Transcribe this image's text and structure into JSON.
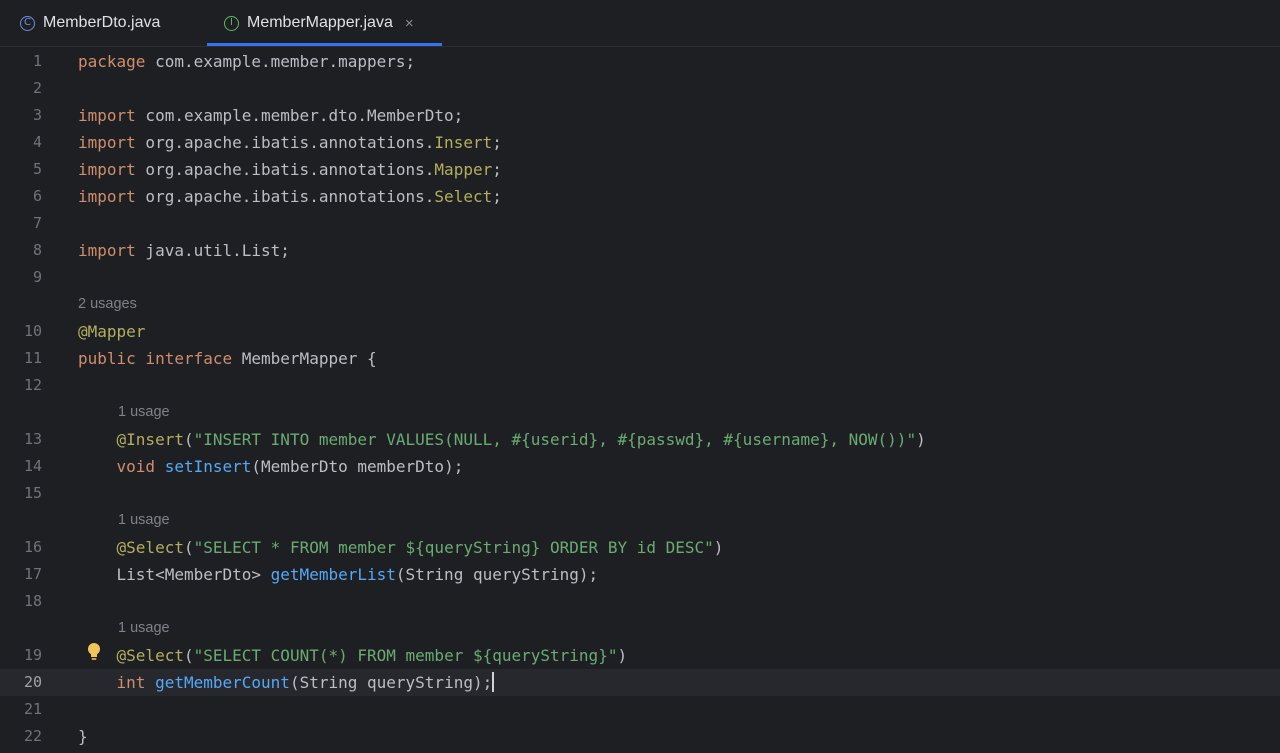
{
  "tabs": [
    {
      "label": "MemberDto.java",
      "icon": "class-icon",
      "glyph": "C",
      "active": false
    },
    {
      "label": "MemberMapper.java",
      "icon": "interface-icon",
      "glyph": "I",
      "active": true,
      "close": "×"
    }
  ],
  "colors": {
    "background": "#1e1f22",
    "keyword": "#cf8e6d",
    "annotation": "#b3ae60",
    "string": "#6aab73",
    "method": "#56a8f5",
    "text": "#bcbec4",
    "accent": "#3574f0"
  },
  "editor": {
    "current_line": 20,
    "lines": [
      {
        "n": "1",
        "segments": [
          [
            "kw",
            "package"
          ],
          [
            "txt",
            " com.example.member.mappers;"
          ]
        ]
      },
      {
        "n": "2",
        "segments": []
      },
      {
        "n": "3",
        "segments": [
          [
            "kw",
            "import"
          ],
          [
            "txt",
            " com.example.member.dto.MemberDto;"
          ]
        ]
      },
      {
        "n": "4",
        "segments": [
          [
            "kw",
            "import"
          ],
          [
            "txt",
            " org.apache.ibatis.annotations."
          ],
          [
            "ann",
            "Insert"
          ],
          [
            "txt",
            ";"
          ]
        ]
      },
      {
        "n": "5",
        "segments": [
          [
            "kw",
            "import"
          ],
          [
            "txt",
            " org.apache.ibatis.annotations."
          ],
          [
            "ann",
            "Mapper"
          ],
          [
            "txt",
            ";"
          ]
        ]
      },
      {
        "n": "6",
        "segments": [
          [
            "kw",
            "import"
          ],
          [
            "txt",
            " org.apache.ibatis.annotations."
          ],
          [
            "ann",
            "Select"
          ],
          [
            "txt",
            ";"
          ]
        ]
      },
      {
        "n": "7",
        "segments": []
      },
      {
        "n": "8",
        "segments": [
          [
            "kw",
            "import"
          ],
          [
            "txt",
            " java.util.List;"
          ]
        ]
      },
      {
        "n": "9",
        "segments": []
      },
      {
        "hint": "2 usages",
        "indent": 0
      },
      {
        "n": "10",
        "segments": [
          [
            "ann",
            "@Mapper"
          ]
        ]
      },
      {
        "n": "11",
        "segments": [
          [
            "kw",
            "public interface"
          ],
          [
            "txt",
            " MemberMapper {"
          ]
        ]
      },
      {
        "n": "12",
        "segments": []
      },
      {
        "hint": "1 usage",
        "indent": 1
      },
      {
        "n": "13",
        "segments": [
          [
            "txt",
            "    "
          ],
          [
            "ann",
            "@Insert"
          ],
          [
            "txt",
            "("
          ],
          [
            "str",
            "\"INSERT INTO member VALUES(NULL, #{userid}, #{passwd}, #{username}, NOW())\""
          ],
          [
            "txt",
            ")"
          ]
        ]
      },
      {
        "n": "14",
        "segments": [
          [
            "txt",
            "    "
          ],
          [
            "kw",
            "void"
          ],
          [
            "txt",
            " "
          ],
          [
            "fn",
            "setInsert"
          ],
          [
            "txt",
            "(MemberDto memberDto);"
          ]
        ]
      },
      {
        "n": "15",
        "segments": []
      },
      {
        "hint": "1 usage",
        "indent": 1
      },
      {
        "n": "16",
        "segments": [
          [
            "txt",
            "    "
          ],
          [
            "ann",
            "@Select"
          ],
          [
            "txt",
            "("
          ],
          [
            "str",
            "\"SELECT * FROM member ${queryString} ORDER BY id DESC\""
          ],
          [
            "txt",
            ")"
          ]
        ]
      },
      {
        "n": "17",
        "segments": [
          [
            "txt",
            "    List<MemberDto> "
          ],
          [
            "fn",
            "getMemberList"
          ],
          [
            "txt",
            "(String queryString);"
          ]
        ]
      },
      {
        "n": "18",
        "segments": []
      },
      {
        "hint": "1 usage",
        "indent": 1
      },
      {
        "n": "19",
        "bulb": true,
        "segments": [
          [
            "txt",
            "    "
          ],
          [
            "ann",
            "@Select"
          ],
          [
            "txt",
            "("
          ],
          [
            "str",
            "\"SELECT COUNT(*) FROM member ${queryString}\""
          ],
          [
            "txt",
            ")"
          ]
        ]
      },
      {
        "n": "20",
        "caret": true,
        "segments": [
          [
            "txt",
            "    "
          ],
          [
            "kw",
            "int"
          ],
          [
            "txt",
            " "
          ],
          [
            "fn",
            "getMemberCount"
          ],
          [
            "txt",
            "(String queryString);"
          ]
        ]
      },
      {
        "n": "21",
        "segments": []
      },
      {
        "n": "22",
        "segments": [
          [
            "txt",
            "}"
          ]
        ]
      }
    ]
  }
}
